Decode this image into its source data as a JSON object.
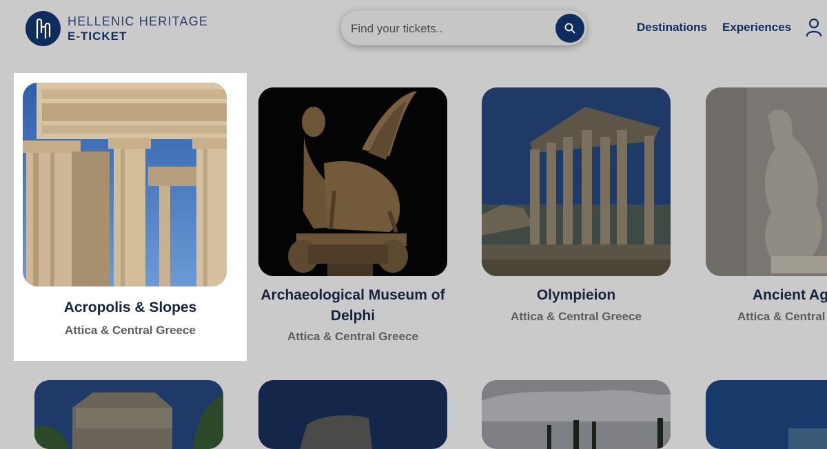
{
  "brand": {
    "line1": "HELLENIC HERITAGE",
    "line2": "E-TICKET"
  },
  "search": {
    "placeholder": "Find your tickets.."
  },
  "nav": {
    "destinations": "Destinations",
    "experiences": "Experiences"
  },
  "icons": [
    "logo-icon",
    "search-icon",
    "user-icon"
  ],
  "cards": [
    {
      "title": "Acropolis & Slopes",
      "subtitle": "Attica & Central Greece",
      "selected": true
    },
    {
      "title_line1": "Archaeological Museum of",
      "title_line2": "Delphi",
      "subtitle": "Attica & Central Greece"
    },
    {
      "title": "Olympieion",
      "subtitle": "Attica & Central Greece"
    },
    {
      "title": "Ancient Ago",
      "subtitle": "Attica & Central G"
    }
  ],
  "colors": {
    "brand": "#0f2d5c",
    "page_overlay": "#cacaca",
    "highlight": "#ffffff"
  }
}
